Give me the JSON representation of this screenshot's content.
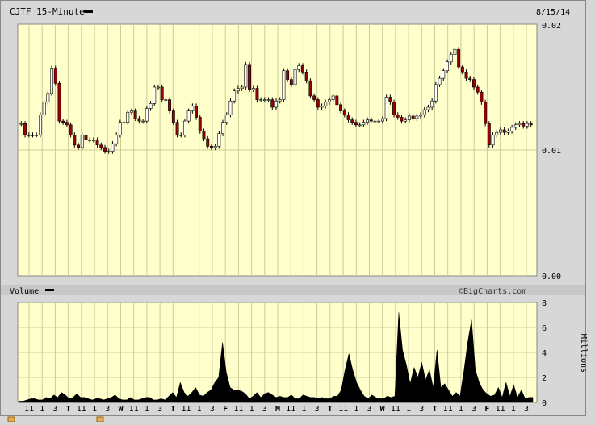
{
  "header": {
    "symbol_label": "CJTF 15-Minute",
    "date_label": "8/15/14"
  },
  "volume_panel": {
    "label": "Volume",
    "credit": "©BigCharts.com",
    "units_label": "Millions"
  },
  "colors": {
    "background": "#ffffcc",
    "frame": "#d7d7d7",
    "grid": "#cccc99",
    "up_candle": "#ffffff",
    "down_candle": "#990000",
    "volume": "#000000"
  },
  "chart_data": [
    {
      "type": "candlestick",
      "title": "CJTF 15-Minute",
      "y_ticks": [
        "0.02",
        "0.01",
        "0.00"
      ],
      "ylim": [
        0,
        0.02
      ],
      "grid": true,
      "x_ticks": [
        "11",
        "1",
        "3",
        "T",
        "11",
        "1",
        "3",
        "W",
        "11",
        "1",
        "3",
        "T",
        "11",
        "1",
        "3",
        "F",
        "11",
        "1",
        "3",
        "M",
        "11",
        "1",
        "3",
        "T",
        "11",
        "1",
        "3",
        "W",
        "11",
        "1",
        "3",
        "T",
        "11",
        "1",
        "3",
        "F",
        "11",
        "1",
        "3"
      ],
      "price_series": [
        0.0121,
        0.0112,
        0.0112,
        0.0112,
        0.0112,
        0.0128,
        0.0138,
        0.0145,
        0.0165,
        0.0153,
        0.0123,
        0.0122,
        0.012,
        0.0112,
        0.0104,
        0.0102,
        0.0112,
        0.0108,
        0.0108,
        0.0108,
        0.0104,
        0.0102,
        0.0099,
        0.0099,
        0.0105,
        0.0112,
        0.0122,
        0.0122,
        0.013,
        0.0131,
        0.0125,
        0.0123,
        0.0123,
        0.0133,
        0.0137,
        0.015,
        0.015,
        0.014,
        0.014,
        0.0131,
        0.0122,
        0.0112,
        0.0112,
        0.0123,
        0.0131,
        0.0135,
        0.0126,
        0.0115,
        0.0109,
        0.0103,
        0.0102,
        0.0103,
        0.0113,
        0.0122,
        0.0128,
        0.0139,
        0.0147,
        0.0149,
        0.015,
        0.0168,
        0.0148,
        0.0149,
        0.014,
        0.014,
        0.014,
        0.014,
        0.0134,
        0.0139,
        0.014,
        0.0163,
        0.0156,
        0.0152,
        0.0164,
        0.0167,
        0.0162,
        0.0155,
        0.0143,
        0.014,
        0.0134,
        0.0135,
        0.0138,
        0.014,
        0.0143,
        0.0136,
        0.0131,
        0.0128,
        0.0124,
        0.0122,
        0.012,
        0.012,
        0.0122,
        0.0124,
        0.0123,
        0.0123,
        0.0123,
        0.0125,
        0.0142,
        0.0138,
        0.0128,
        0.0126,
        0.0123,
        0.0124,
        0.0127,
        0.0125,
        0.0127,
        0.0128,
        0.0132,
        0.0134,
        0.0139,
        0.0152,
        0.0157,
        0.0163,
        0.017,
        0.0176,
        0.018,
        0.0166,
        0.0162,
        0.0157,
        0.0156,
        0.015,
        0.0146,
        0.0138,
        0.0121,
        0.0104,
        0.0112,
        0.0114,
        0.0116,
        0.0114,
        0.0115,
        0.0118,
        0.012,
        0.0121,
        0.0119,
        0.0121,
        0.012
      ],
      "volume_series_millions": [
        0.1,
        0.1,
        0.2,
        0.3,
        0.3,
        0.2,
        0.2,
        0.4,
        0.3,
        0.6,
        0.4,
        0.8,
        0.6,
        0.3,
        0.4,
        0.7,
        0.4,
        0.4,
        0.3,
        0.2,
        0.3,
        0.3,
        0.2,
        0.3,
        0.4,
        0.6,
        0.3,
        0.2,
        0.2,
        0.4,
        0.2,
        0.2,
        0.3,
        0.4,
        0.4,
        0.2,
        0.2,
        0.3,
        0.2,
        0.5,
        0.8,
        0.4,
        1.6,
        0.8,
        0.5,
        0.8,
        1.2,
        0.6,
        0.5,
        0.8,
        1.0,
        1.6,
        2.0,
        4.8,
        2.4,
        1.2,
        1.0,
        1.0,
        0.9,
        0.7,
        0.3,
        0.5,
        0.8,
        0.4,
        0.7,
        0.8,
        0.6,
        0.4,
        0.5,
        0.4,
        0.4,
        0.6,
        0.3,
        0.3,
        0.6,
        0.5,
        0.4,
        0.4,
        0.3,
        0.4,
        0.3,
        0.3,
        0.5,
        0.5,
        1.0,
        2.6,
        3.9,
        2.6,
        1.6,
        1.0,
        0.5,
        0.3,
        0.6,
        0.4,
        0.3,
        0.3,
        0.5,
        0.4,
        0.5,
        7.2,
        4.2,
        3.0,
        1.5,
        2.8,
        2.0,
        3.2,
        1.8,
        2.6,
        1.2,
        4.2,
        1.2,
        1.5,
        1.0,
        0.5,
        0.8,
        0.5,
        2.5,
        4.8,
        6.6,
        2.6,
        1.6,
        1.0,
        0.7,
        0.5,
        0.6,
        1.2,
        0.4,
        1.6,
        0.5,
        1.4,
        0.4,
        1.0,
        0.3,
        0.4,
        0.4
      ],
      "volume_y_ticks": [
        "8",
        "6",
        "4",
        "2",
        "0"
      ],
      "volume_ylim": [
        0,
        8
      ]
    }
  ]
}
